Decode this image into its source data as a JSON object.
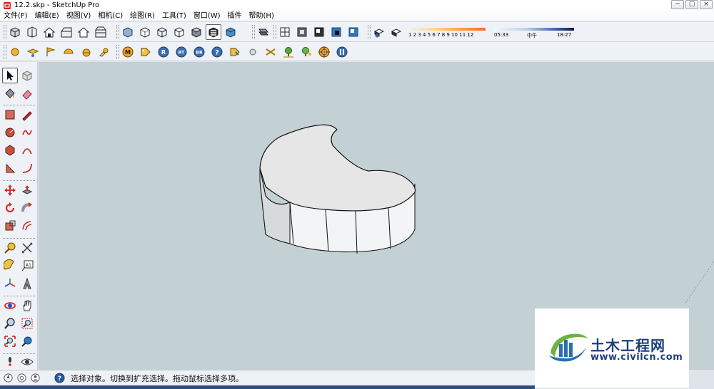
{
  "window": {
    "title": "12.2.skp - SketchUp Pro",
    "app_icon": "sketchup-logo-icon",
    "controls": {
      "minimize": "−",
      "maximize": "▢",
      "close": "×"
    }
  },
  "menu": {
    "items": [
      {
        "label": "文件(F)"
      },
      {
        "label": "编辑(E)"
      },
      {
        "label": "视图(V)"
      },
      {
        "label": "相机(C)"
      },
      {
        "label": "绘图(R)"
      },
      {
        "label": "工具(T)"
      },
      {
        "label": "窗口(W)"
      },
      {
        "label": "插件"
      },
      {
        "label": "帮助(H)"
      }
    ]
  },
  "toolbar": {
    "views_group": [
      "iso-view-icon",
      "top-view-icon",
      "front-view-icon",
      "right-view-icon",
      "back-view-icon",
      "left-view-icon"
    ],
    "style_group": [
      "xray-icon",
      "back-edges-icon",
      "wireframe-icon",
      "hidden-line-icon",
      "shaded-icon",
      "shaded-textures-icon",
      "monochrome-icon"
    ],
    "section_group": [
      "section-plane-icon"
    ],
    "components_group": [
      "component-a-icon",
      "component-b-icon",
      "component-c-icon",
      "component-d-icon",
      "component-e-icon"
    ],
    "shadow_group": [
      "shadow-settings-icon",
      "display-shadows-icon"
    ],
    "active_style_index": 5,
    "shadows": {
      "month_ticks": "1  2  3  4  5  6  7  8  9  10 11 12",
      "time_start": "05:33",
      "time_mid": "中午",
      "time_end": "18:27"
    },
    "row2_icons": [
      "sphere-gold-icon",
      "layer-icon",
      "flag-icon",
      "half-sphere-icon",
      "sphere-half-icon",
      "hand-sphere-icon",
      "m-circle-icon",
      "tag-icon",
      "r-circle-icon",
      "rt-circle-icon",
      "br-circle-icon",
      "help-circle-icon",
      "tag-key-icon",
      "ball-icon",
      "cross-tool-icon",
      "tree-icon",
      "tree-2-icon",
      "target-icon",
      "pause-circle-icon"
    ],
    "row2_labels": {
      "m": "M",
      "r": "R",
      "rt": "RT",
      "br": "BR",
      "help": "?"
    }
  },
  "left_tools": [
    {
      "name": "select-tool",
      "icon": "arrow-cursor-icon",
      "active": true
    },
    {
      "name": "make-component-tool",
      "icon": "component-cube-icon"
    },
    {
      "name": "paint-bucket-tool",
      "icon": "paint-bucket-icon"
    },
    {
      "name": "eraser-tool",
      "icon": "eraser-icon"
    },
    {
      "name": "rectangle-tool",
      "icon": "rectangle-icon"
    },
    {
      "name": "line-tool",
      "icon": "pencil-icon"
    },
    {
      "name": "circle-tool",
      "icon": "circle-icon"
    },
    {
      "name": "freehand-tool",
      "icon": "freehand-icon"
    },
    {
      "name": "polygon-tool",
      "icon": "polygon-icon"
    },
    {
      "name": "arc-tool",
      "icon": "arc-icon"
    },
    {
      "name": "pie-tool",
      "icon": "pie-icon"
    },
    {
      "name": "arc2-tool",
      "icon": "arc2-icon"
    },
    {
      "name": "move-tool",
      "icon": "move-arrows-icon"
    },
    {
      "name": "push-pull-tool",
      "icon": "push-pull-icon"
    },
    {
      "name": "rotate-tool",
      "icon": "rotate-icon"
    },
    {
      "name": "follow-me-tool",
      "icon": "follow-me-icon"
    },
    {
      "name": "scale-tool",
      "icon": "scale-icon"
    },
    {
      "name": "offset-tool",
      "icon": "offset-icon"
    },
    {
      "name": "tape-measure-tool",
      "icon": "tape-measure-icon"
    },
    {
      "name": "dimension-tool",
      "icon": "dimension-icon"
    },
    {
      "name": "protractor-tool",
      "icon": "protractor-icon"
    },
    {
      "name": "text-tool",
      "icon": "text-label-icon",
      "label": "A1"
    },
    {
      "name": "axes-tool",
      "icon": "axes-icon"
    },
    {
      "name": "3d-text-tool",
      "icon": "3d-text-icon"
    },
    {
      "name": "orbit-tool",
      "icon": "orbit-icon"
    },
    {
      "name": "pan-tool",
      "icon": "hand-icon"
    },
    {
      "name": "zoom-tool",
      "icon": "magnifier-icon"
    },
    {
      "name": "zoom-window-tool",
      "icon": "zoom-window-icon"
    },
    {
      "name": "zoom-extents-tool",
      "icon": "zoom-extents-icon"
    },
    {
      "name": "previous-view-tool",
      "icon": "previous-view-icon"
    },
    {
      "name": "walk-tool",
      "icon": "footsteps-icon"
    },
    {
      "name": "look-around-tool",
      "icon": "eye-icon"
    }
  ],
  "status": {
    "text": "选择对象。切换到扩充选择。拖动鼠标选择多项。",
    "icons": [
      "geo-location-icon",
      "credits-icon",
      "user-icon",
      "help-icon"
    ]
  },
  "watermark": {
    "title": "土木工程网",
    "url": "www.civilcn.com"
  },
  "colors": {
    "viewport_bg": "#c4d1d4",
    "model_top": "#e6e6e6",
    "model_side": "#f4f5f6",
    "watermark_blue": "#1f3f7a"
  }
}
